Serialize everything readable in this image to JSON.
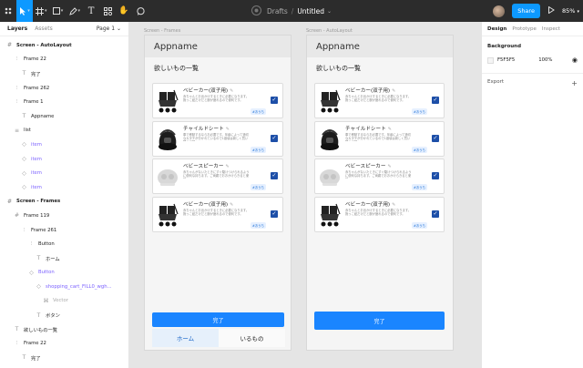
{
  "toolbar": {
    "breadcrumb": "Drafts",
    "separator": "/",
    "file_title": "Untitled",
    "title_caret": "⌄",
    "share_label": "Share",
    "zoom": "85%",
    "icons": [
      "figma-menu-icon",
      "move-tool-icon",
      "frame-tool-icon",
      "shape-tool-icon",
      "pen-tool-icon",
      "text-tool-icon",
      "resources-icon",
      "hand-tool-icon",
      "comment-icon",
      "team-icon",
      "avatar",
      "play-icon"
    ]
  },
  "left_panel": {
    "tabs": [
      "Layers",
      "Assets"
    ],
    "page": "Page 1 ⌄",
    "layers": [
      {
        "icon": "#",
        "label": "Screen - AutoLayout",
        "indent": 0,
        "bold": true,
        "comp": false
      },
      {
        "icon": "⫶",
        "label": "Frame 22",
        "indent": 1,
        "bold": false,
        "comp": false
      },
      {
        "icon": "T",
        "label": "完了",
        "indent": 2,
        "bold": false,
        "comp": false
      },
      {
        "icon": "⫶",
        "label": "Frame 262",
        "indent": 1,
        "bold": false,
        "comp": false
      },
      {
        "icon": "⫶",
        "label": "Frame 1",
        "indent": 1,
        "bold": false,
        "comp": false
      },
      {
        "icon": "T",
        "label": "Appname",
        "indent": 2,
        "bold": false,
        "comp": false
      },
      {
        "icon": "≡",
        "label": "list",
        "indent": 1,
        "bold": false,
        "comp": false
      },
      {
        "icon": "◇",
        "label": "item",
        "indent": 2,
        "bold": false,
        "comp": true
      },
      {
        "icon": "◇",
        "label": "item",
        "indent": 2,
        "bold": false,
        "comp": true
      },
      {
        "icon": "◇",
        "label": "item",
        "indent": 2,
        "bold": false,
        "comp": true
      },
      {
        "icon": "◇",
        "label": "item",
        "indent": 2,
        "bold": false,
        "comp": true
      },
      {
        "icon": "#",
        "label": "Screen - Frames",
        "indent": 0,
        "bold": true,
        "comp": false
      },
      {
        "icon": "#",
        "label": "Frame 119",
        "indent": 1,
        "bold": false,
        "comp": false
      },
      {
        "icon": "⫶",
        "label": "Frame 261",
        "indent": 2,
        "bold": false,
        "comp": false
      },
      {
        "icon": "⫶",
        "label": "Button",
        "indent": 3,
        "bold": false,
        "comp": false
      },
      {
        "icon": "T",
        "label": "ホーム",
        "indent": 4,
        "bold": false,
        "comp": false
      },
      {
        "icon": "◇",
        "label": "Button",
        "indent": 3,
        "bold": false,
        "comp": true
      },
      {
        "icon": "◇",
        "label": "shopping_cart_FILL0_wgh...",
        "indent": 4,
        "bold": false,
        "comp": true
      },
      {
        "icon": "⌘",
        "label": "Vector",
        "indent": 5,
        "bold": false,
        "comp": false,
        "muted": true
      },
      {
        "icon": "T",
        "label": "ボタン",
        "indent": 4,
        "bold": false,
        "comp": false
      },
      {
        "icon": "T",
        "label": "欲しいもの一覧",
        "indent": 1,
        "bold": false,
        "comp": false
      },
      {
        "icon": "⫶",
        "label": "Frame 22",
        "indent": 1,
        "bold": false,
        "comp": false
      },
      {
        "icon": "T",
        "label": "完了",
        "indent": 2,
        "bold": false,
        "comp": false
      }
    ]
  },
  "right_panel": {
    "tabs": [
      "Design",
      "Prototype",
      "Inspect"
    ],
    "background_label": "Background",
    "bg_hex": "F5F5F5",
    "bg_opacity": "100%",
    "export_label": "Export",
    "add_symbol": "+"
  },
  "frames": [
    {
      "label": "Screen - Frames",
      "appname": "Appname",
      "list_title": "欲しいもの一覧",
      "done_label": "完了",
      "nav": [
        "ホーム",
        "いるもの"
      ]
    },
    {
      "label": "Screen - AutoLayout",
      "appname": "Appname",
      "list_title": "欲しいもの一覧",
      "done_label": "完了"
    }
  ],
  "items": [
    {
      "name": "ベビーカー(双子用)",
      "desc": "赤ちゃんとお出かけするときに必要になります。抱っこ紐だけだと腕が疲れるので便利です。",
      "tag": "#おうち",
      "img": "stroller"
    },
    {
      "name": "チャイルドシート",
      "desc": "車で移動するならお必要です。年齢によって適切なカタチが分かれているので1歳頃は新しく買い替え必須。",
      "tag": "#おうち",
      "img": "carseat"
    },
    {
      "name": "ベビースピーカー",
      "desc": "赤ちゃんがないたときにすぐ駆けつけられるように便利な持ちます。ご両親でおおかけらきると便利。",
      "tag": "#おうち",
      "img": "speaker"
    },
    {
      "name": "ベビーカー(双子用)",
      "desc": "赤ちゃんとお出かけするときに必要になります。抱っこ紐だけだと腕が疲れるので便利です。",
      "tag": "#おうち",
      "img": "stroller"
    }
  ],
  "checkmark": "✓",
  "edit_icon": "✎"
}
